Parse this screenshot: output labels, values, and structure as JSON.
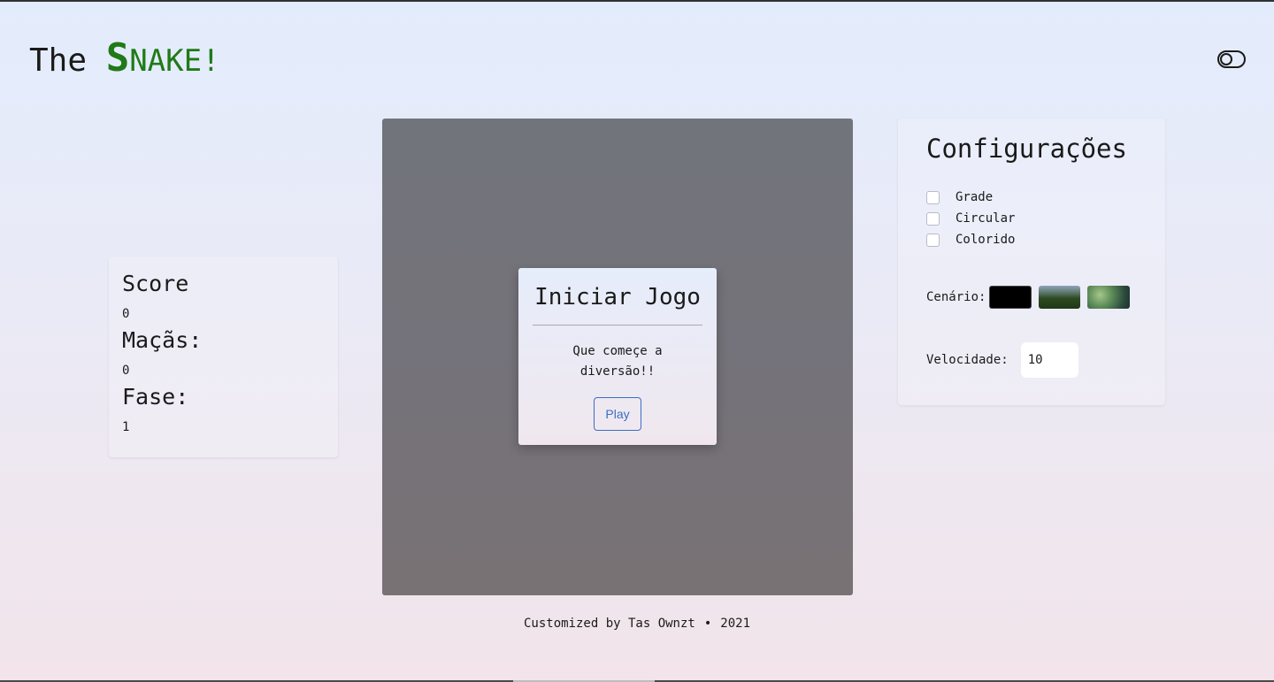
{
  "header": {
    "title_prefix": "The ",
    "title_big": "S",
    "title_rest": "NAKE!",
    "theme_toggle": "theme-toggle"
  },
  "stats": {
    "score_label": "Score",
    "score_value": "0",
    "apples_label": "Maçãs:",
    "apples_value": "0",
    "level_label": "Fase:",
    "level_value": "1"
  },
  "modal": {
    "title": "Iniciar Jogo",
    "message": "Que começe a diversão!!",
    "play_label": "Play"
  },
  "config": {
    "title": "Configurações",
    "options": [
      {
        "label": "Grade",
        "checked": false
      },
      {
        "label": "Circular",
        "checked": false
      },
      {
        "label": "Colorido",
        "checked": false
      }
    ],
    "scenery_label": "Cenário:",
    "speed_label": "Velocidade:",
    "speed_value": "10"
  },
  "footer": {
    "credit": "Customized by Tas Ownzt",
    "separator": "•",
    "year": "2021"
  },
  "colors": {
    "snake_green": "#1f7a17",
    "accent_blue": "#3b6fc4",
    "board_gray": "#75737a"
  }
}
